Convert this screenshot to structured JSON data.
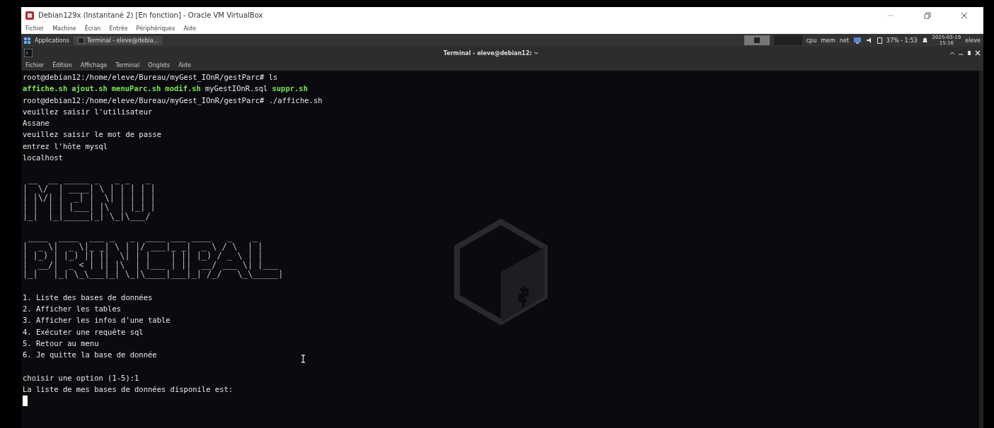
{
  "window": {
    "title": "Debian129x (Instantané 2) [En fonction] - Oracle VM VirtualBox"
  },
  "vbox_menu": [
    "Fichier",
    "Machine",
    "Écran",
    "Entrée",
    "Périphériques",
    "Aide"
  ],
  "guest_panel": {
    "apps_label": "Applications",
    "task": "Terminal - eleve@debia...",
    "monitors": [
      "cpu",
      "mem",
      "net"
    ],
    "battery": "37% - 1:53",
    "clock": [
      "2025-03-19",
      "15:16"
    ],
    "user": "eleve"
  },
  "terminal": {
    "title": "Terminal - eleve@debian12: ~",
    "menu": [
      "Fichier",
      "Édition",
      "Affichage",
      "Terminal",
      "Onglets",
      "Aide"
    ],
    "lines": [
      {
        "kind": "text",
        "text": "root@debian12:/home/eleve/Bureau/myGest_IOnR/gestParc# ls"
      },
      {
        "kind": "files",
        "files": [
          {
            "name": "affiche.sh",
            "executable": true
          },
          {
            "name": "ajout.sh",
            "executable": true
          },
          {
            "name": "menuParc.sh",
            "executable": true
          },
          {
            "name": "modif.sh",
            "executable": true
          },
          {
            "name": "myGestIOnR.sql",
            "executable": false
          },
          {
            "name": "suppr.sh",
            "executable": true
          }
        ]
      },
      {
        "kind": "text",
        "text": "root@debian12:/home/eleve/Bureau/myGest_IOnR/gestParc# ./affiche.sh"
      },
      {
        "kind": "text",
        "text": "veuillez saisir l'utilisateur"
      },
      {
        "kind": "text",
        "text": "Assane"
      },
      {
        "kind": "text",
        "text": "veuillez saisir le mot de passe"
      },
      {
        "kind": "text",
        "text": "entrez l'hôte mysql"
      },
      {
        "kind": "text",
        "text": "localhost"
      },
      {
        "kind": "blank"
      },
      {
        "kind": "banner",
        "rows": [
          " __  __ _____ _   _ _   _ ",
          "|  \\/  | ____| \\ | | | | |",
          "| |\\/| |  _| |  \\| | | | |",
          "| |  | | |___| |\\  | |_| |",
          "|_|  |_|_____|_| \\_|\\___/ "
        ]
      },
      {
        "kind": "blank"
      },
      {
        "kind": "banner",
        "rows": [
          " ____  ____  ___ _   _  ____ ___ ____   _    _     ",
          "|  _ \\|  _ \\|_ _| \\ | |/ ___|_ _|  _ \\ / \\  | |    ",
          "| |_) | |_) || ||  \\| | |    | || |_) / _ \\ | |    ",
          "|  __/|  _ < | || |\\  | |___ | ||  __/ ___ \\| |___ ",
          "|_|   |_| \\_\\___|_| \\_|\\____|___|_| /_/   \\_\\_____|"
        ]
      },
      {
        "kind": "blank"
      },
      {
        "kind": "text",
        "text": "1. Liste des bases de données"
      },
      {
        "kind": "text",
        "text": "2. Afficher les tables"
      },
      {
        "kind": "text",
        "text": "3. Afficher les infos d'une table"
      },
      {
        "kind": "text",
        "text": "4. Exécuter une requête sql"
      },
      {
        "kind": "text",
        "text": "5. Retour au menu"
      },
      {
        "kind": "text",
        "text": "6. Je quitte la base de donnée"
      },
      {
        "kind": "blank"
      },
      {
        "kind": "text",
        "text": "choisir une option (1-5):1"
      },
      {
        "kind": "text",
        "text": "La liste de mes bases de données disponile est:"
      },
      {
        "kind": "cursor"
      }
    ]
  }
}
